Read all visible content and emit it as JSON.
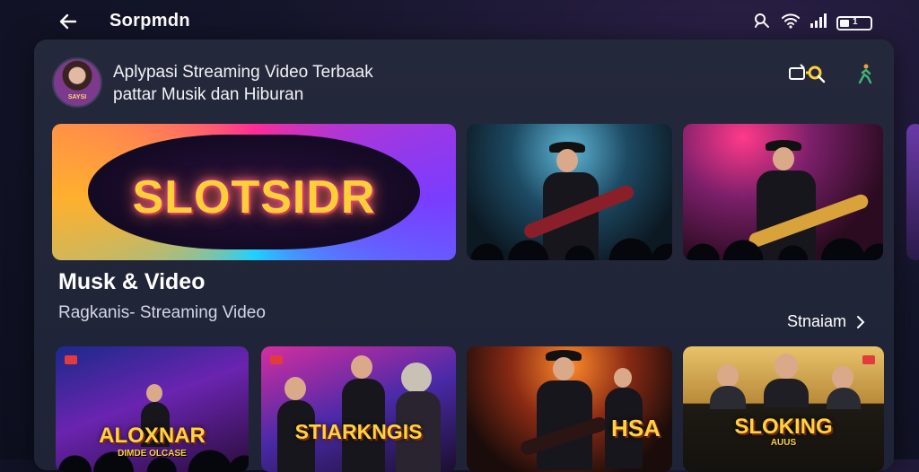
{
  "app": {
    "title": "Sorpmdn"
  },
  "status": {
    "battery_text": "1"
  },
  "header": {
    "avatar_label": "SAYSI",
    "headline_line1": "Aplypasi Streaming Video Terbaak",
    "headline_line2": "pattar Musik dan Hiburan"
  },
  "featured": {
    "hero_title": "SLOTSIDR"
  },
  "section": {
    "title": "Musk & Video",
    "subtitle": "Ragkanis- Streaming Video",
    "see_all_label": "Stnaiam"
  },
  "thumbnails": [
    {
      "title": "ALOXNAR",
      "subtitle": "DIMDE OLCASE"
    },
    {
      "title": "STIARKNGIS",
      "subtitle": ""
    },
    {
      "title": "HSA",
      "subtitle": ""
    },
    {
      "title": "SLOKING",
      "subtitle": "AUUS"
    }
  ],
  "colors": {
    "accent_yellow": "#ffcf3a",
    "panel": "#24283b",
    "background": "#14152a"
  },
  "icons": [
    "back-arrow-icon",
    "search-person-icon",
    "wifi-icon",
    "signal-icon",
    "battery-icon",
    "cast-icon",
    "search-icon",
    "figure-icon",
    "chevron-right-icon"
  ]
}
